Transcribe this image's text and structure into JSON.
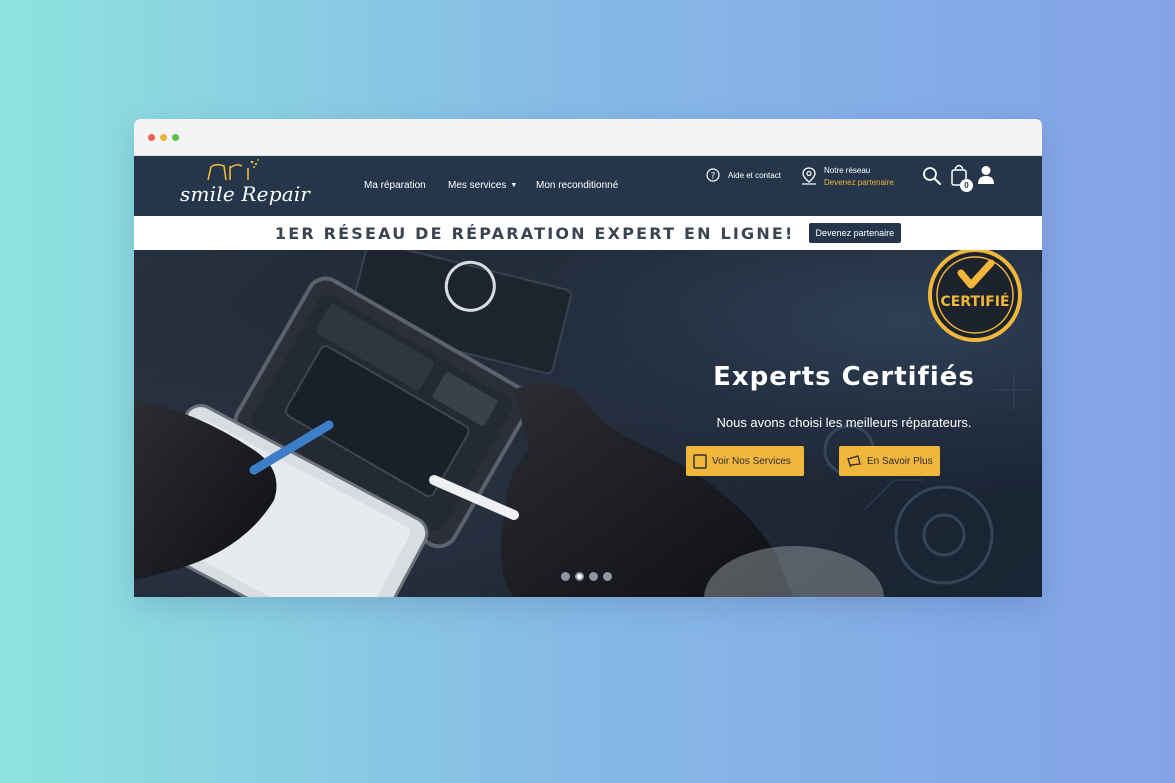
{
  "brand": {
    "name": "smile Repair",
    "accent": "#f2b63b",
    "nav_bg": "#25364b"
  },
  "nav": {
    "links": [
      {
        "label": "Ma réparation"
      },
      {
        "label": "Mes services"
      },
      {
        "label": "Mon reconditionné"
      }
    ],
    "help_label": "Aide et contact",
    "network_title": "Notre réseau",
    "network_link": "Devenez partenaire",
    "cart_count": "0",
    "icons": [
      "help-icon",
      "map-pin-icon",
      "search-icon",
      "cart-icon",
      "user-icon"
    ]
  },
  "banner": {
    "text": "1ER RÉSEAU DE RÉPARATION EXPERT EN LIGNE!",
    "button": "Devenez partenaire"
  },
  "hero": {
    "title": "Experts Certifiés",
    "subtitle": "Nous avons choisi les meilleurs réparateurs.",
    "button_primary": "Voir Nos Services",
    "button_secondary": "En Savoir Plus",
    "badge_text": "CERTIFIÉ",
    "carousel_total": 4,
    "carousel_active": 2
  }
}
